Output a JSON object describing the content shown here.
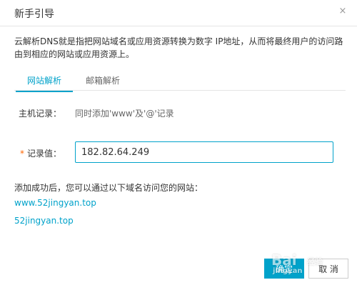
{
  "dialog": {
    "title": "新手引导",
    "close_glyph": "×"
  },
  "intro_text": "云解析DNS就是指把网站域名或应用资源转换为数字 IP地址，从而将最终用户的访问路由到相应的网站或应用资源上。",
  "tabs": [
    {
      "label": "网站解析",
      "active": true
    },
    {
      "label": "邮箱解析",
      "active": false
    }
  ],
  "host_record": {
    "label": "主机记录：",
    "value": "同时添加'www'及'@'记录"
  },
  "record_value": {
    "required_mark": "*",
    "label": "记录值：",
    "value": "182.82.64.249"
  },
  "success_message": "添加成功后，您可以通过以下域名访问您的网站：",
  "domains": [
    "www.52jingyan.top",
    "52jingyan.top"
  ],
  "buttons": {
    "confirm": "确定",
    "cancel": "取 消"
  },
  "watermark": {
    "brand": "Bai",
    "sub": "jingyan",
    "tail": "经验"
  },
  "colors": {
    "accent": "#00a2ca",
    "required": "#ff6600"
  }
}
